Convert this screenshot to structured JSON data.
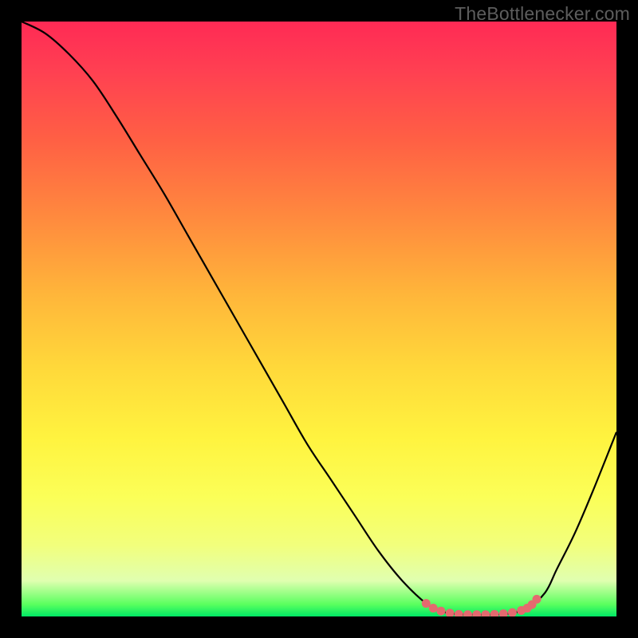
{
  "watermark": "TheBottlenecker.com",
  "colors": {
    "curve": "#000000",
    "marker": "#e46a6f",
    "background": "#000000"
  },
  "chart_data": {
    "type": "line",
    "title": "",
    "xlabel": "",
    "ylabel": "",
    "xlim": [
      0,
      100
    ],
    "ylim": [
      0,
      100
    ],
    "grid": false,
    "series": [
      {
        "name": "bottleneck-curve",
        "x": [
          0,
          4,
          8,
          12,
          16,
          20,
          24,
          28,
          32,
          36,
          40,
          44,
          48,
          52,
          56,
          60,
          64,
          68,
          70.5,
          73,
          76,
          79,
          82,
          85,
          88,
          90,
          93,
          96,
          100
        ],
        "y": [
          100,
          98,
          94.5,
          90,
          84,
          77.5,
          71,
          64,
          57,
          50,
          43,
          36,
          29,
          23,
          17,
          11,
          6,
          2.2,
          0.9,
          0.4,
          0.3,
          0.3,
          0.5,
          1.4,
          4,
          8,
          14,
          21,
          31
        ]
      }
    ],
    "markers": {
      "name": "valley-markers",
      "x": [
        68,
        69.2,
        70.5,
        72,
        73.5,
        75,
        76.5,
        78,
        79.5,
        81,
        82.5,
        84,
        85,
        85.8,
        86.6
      ],
      "y": [
        2.2,
        1.4,
        0.9,
        0.55,
        0.35,
        0.3,
        0.3,
        0.3,
        0.35,
        0.45,
        0.65,
        1.0,
        1.4,
        2.0,
        2.9
      ],
      "radius": 5.5
    }
  }
}
